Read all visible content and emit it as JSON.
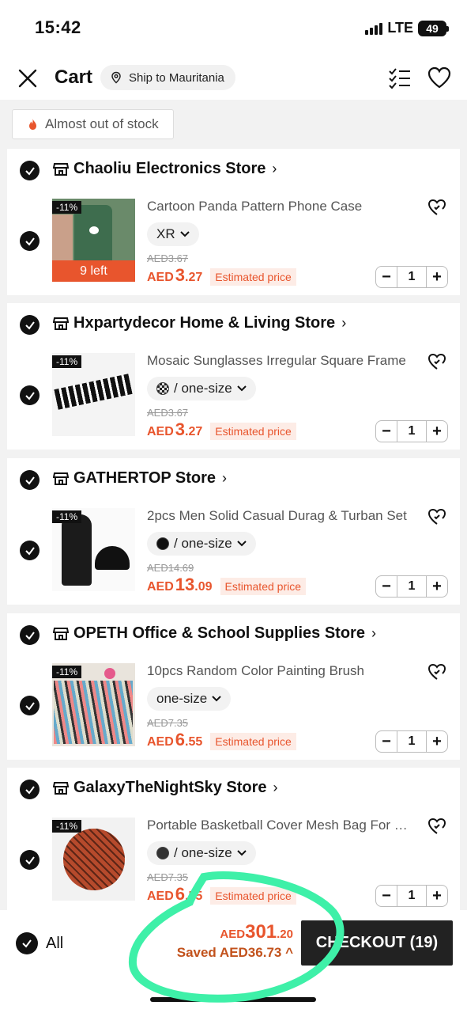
{
  "status": {
    "time": "15:42",
    "network": "LTE",
    "battery": "49"
  },
  "header": {
    "title": "Cart",
    "ship_to": "Ship to Mauritania"
  },
  "filter": {
    "chip": "Almost out of stock"
  },
  "stores": [
    {
      "name": "Chaoliu Electronics Store",
      "item": {
        "title": "Cartoon Panda Pattern Phone Case",
        "variant": "XR",
        "old_price": "AED3.67",
        "currency": "AED",
        "price_int": "3",
        "price_dec": ".27",
        "estimated": "Estimated price",
        "discount": "-11%",
        "stock_note": "9 left",
        "qty": "1"
      }
    },
    {
      "name": "Hxpartydecor Home & Living Store",
      "item": {
        "title": "Mosaic Sunglasses Irregular Square Frame",
        "variant": "/ one-size",
        "old_price": "AED3.67",
        "currency": "AED",
        "price_int": "3",
        "price_dec": ".27",
        "estimated": "Estimated price",
        "discount": "-11%",
        "qty": "1"
      }
    },
    {
      "name": "GATHERTOP Store",
      "item": {
        "title": "2pcs Men Solid Casual Durag & Turban Set",
        "variant": "/ one-size",
        "old_price": "AED14.69",
        "currency": "AED",
        "price_int": "13",
        "price_dec": ".09",
        "estimated": "Estimated price",
        "discount": "-11%",
        "qty": "1"
      }
    },
    {
      "name": "OPETH Office & School Supplies Store",
      "item": {
        "title": "10pcs Random Color Painting Brush",
        "variant": "one-size",
        "old_price": "AED7.35",
        "currency": "AED",
        "price_int": "6",
        "price_dec": ".55",
        "estimated": "Estimated price",
        "discount": "-11%",
        "qty": "1"
      }
    },
    {
      "name": "GalaxyTheNightSky Store",
      "item": {
        "title": "Portable Basketball Cover Mesh Bag For Ball",
        "variant": "/ one-size",
        "old_price": "AED7.35",
        "currency": "AED",
        "price_int": "6",
        "price_dec": ".55",
        "estimated": "Estimated price",
        "discount": "-11%",
        "qty": "1"
      }
    }
  ],
  "footer": {
    "all_label": "All",
    "total_currency": "AED",
    "total_int": "301",
    "total_dec": ".20",
    "saved": "Saved AED36.73 ^",
    "checkout": "CHECKOUT (19)"
  },
  "colors": {
    "accent": "#e8552d",
    "dark": "#111111",
    "annotation": "#3ef0a8"
  }
}
